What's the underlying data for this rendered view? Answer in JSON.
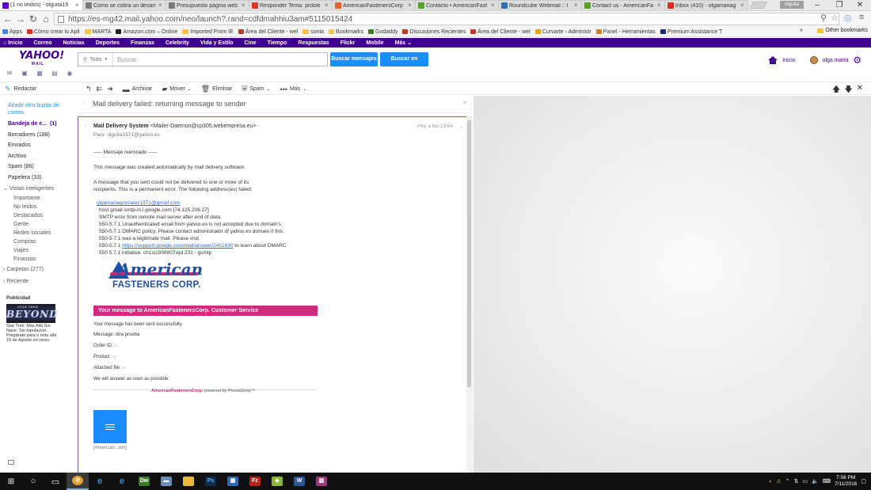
{
  "browser": {
    "tabs": [
      {
        "title": "(1 no leidos) - olguita19",
        "fav": "yahoo-mail-icon",
        "color": "#6001d2",
        "active": true
      },
      {
        "title": "Cómo se cobra un desarr",
        "fav": "page-icon",
        "color": "#7a7a7a",
        "active": false
      },
      {
        "title": "Presupuesto página web",
        "fav": "page-icon",
        "color": "#7a7a7a",
        "active": false
      },
      {
        "title": "Responder Tema: proble",
        "fav": "w-icon",
        "color": "#d9352b",
        "active": false
      },
      {
        "title": "AmericanFastenersCorp",
        "fav": "link-icon",
        "color": "#e8622c",
        "active": false
      },
      {
        "title": "Contacto • AmericanFast",
        "fav": "doc-icon",
        "color": "#5aa02c",
        "active": false
      },
      {
        "title": "Roundcube Webmail :: I",
        "fav": "roundcube-icon",
        "color": "#2b6fb5",
        "active": false
      },
      {
        "title": "Contact us - AmericanFa",
        "fav": "doc-icon",
        "color": "#5aa02c",
        "active": false
      },
      {
        "title": "Inbox (410) - olgamariag",
        "fav": "gmail-icon",
        "color": "#d93025",
        "active": false
      }
    ],
    "window_user": "olguita",
    "url": "https://es-mg42.mail.yahoo.com/neo/launch?.rand=cdfdmahhiu3am#5115015424",
    "bookmarks": [
      {
        "label": "Apps",
        "type": "grid"
      },
      {
        "label": "Cómo crear tu Apli",
        "type": "youtube"
      },
      {
        "label": "MARTA",
        "type": "folder"
      },
      {
        "label": "Amazon.com – Online",
        "type": "amazon"
      },
      {
        "label": "Imported From IE",
        "type": "folder"
      },
      {
        "label": "Área del Cliente - wel",
        "type": "w"
      },
      {
        "label": "sonia",
        "type": "folder"
      },
      {
        "label": "Bookmarks",
        "type": "star"
      },
      {
        "label": "Godaddy",
        "type": "godaddy"
      },
      {
        "label": "Discusiones Recientes",
        "type": "w"
      },
      {
        "label": "Área del Cliente - wel",
        "type": "w"
      },
      {
        "label": "Curvarte › Administr",
        "type": "curvarte"
      },
      {
        "label": "Panel - Herramientas",
        "type": "panel"
      },
      {
        "label": "Premium Assistance T",
        "type": "premium"
      }
    ],
    "other_bookmarks": "Other bookmarks",
    "more_bookmarks": "»"
  },
  "yahoo_nav": [
    "Inicio",
    "Correo",
    "Noticias",
    "Deportes",
    "Finanzas",
    "Celebrity",
    "Vida y Estilo",
    "Cine",
    "Tiempo",
    "Respuestas",
    "Flickr",
    "Mobile",
    "Más"
  ],
  "header": {
    "logo": "YAHOO!",
    "logo_sub": "MAIL",
    "search_scope": "Todo",
    "search_placeholder": "Buscar",
    "btn_search_mail": "Buscar mensajes",
    "btn_search_web": "Buscar en Internet",
    "home": "Inicio",
    "user": "olga maria"
  },
  "actions": {
    "compose": "Redactar",
    "archive": "Archivar",
    "move": "Mover",
    "delete": "Eliminar",
    "spam": "Spam",
    "more": "Más"
  },
  "sidebar": {
    "add_mailbox": "Añadir otro buzón de correo",
    "folders": [
      {
        "label": "Bandeja de e...",
        "count": "(1)",
        "bold": true
      },
      {
        "label": "Borradores (188)",
        "count": "",
        "bold": false
      },
      {
        "label": "Enviados",
        "count": "",
        "bold": false
      },
      {
        "label": "Archivo",
        "count": "",
        "bold": false
      },
      {
        "label": "Spam (86)",
        "count": "",
        "bold": false
      },
      {
        "label": "Papelera (33)",
        "count": "",
        "bold": false
      }
    ],
    "smart_views_title": "Vistas inteligentes",
    "smart_views": [
      "Importante",
      "No leídos",
      "Destacados",
      "Gente",
      "Redes sociales",
      "Compras",
      "Viajes",
      "Finanzas"
    ],
    "carpetas": "Carpetas (277)",
    "reciente": "Reciente",
    "ad_label": "Publicidad",
    "ad_title": "BEYOND",
    "ad_title_small": "STAR TREK",
    "ad_text": "Star Trek: Más Allá Sin Nave. Sin tripulación. Prepárate para ir más allá 19 de Agosto en cines"
  },
  "message": {
    "subject": "Mail delivery failed: returning message to sender",
    "from_name": "Mail Delivery System",
    "from_addr": "<Mailer-Daemon@cp305.webempresa.eu>",
    "to_label": "Para",
    "to_addr": "olguita1971@yahoo.es",
    "time": "Hoy a las 19:54",
    "forwarded": "----- Mensaje reenviado -----",
    "auto_line": "This message was created automatically by mail delivery software.",
    "err_line1": "A message that you sent could not be delivered to one or more of its",
    "err_line2": "recipients. This is a permanent error. The following address(es) failed:",
    "bounce": {
      "address": "olgamariagonzalez1971@gmail.com",
      "host": "host gmail-smtp-in.l.google.com [74.125.206.27]",
      "smtp": "SMTP error from remote mail server after end of data:",
      "l1": "550-5.7.1 Unauthenticated email from yahoo.es is not accepted due to domain's",
      "l2": "550-5.7.1 DMARC policy. Please contact administrator of yahoo.es domain if this",
      "l3": "550-5.7.1 was a legitimate mail. Please visit",
      "l4_pre": "550-5.7.1 ",
      "l4_link": "https://support.google.com/mail/answer/2451690",
      "l4_post": " to learn about DMARC",
      "l5": "550 5.7.1 initiative. ch1si1956907wjd.231 - gsmtp"
    },
    "logo_big": "American",
    "logo_sub": "FASTENERS CORP.",
    "banner": "Your message to AmericanFastenersCorp. Customer Service",
    "sent_ok": "Your message has been sent successfully.",
    "message_line": "Message: otra prueba",
    "order_line": "Order ID : -",
    "product_line": "Product : -",
    "attached_line": "Attached file : -",
    "answer_line": "We will answer as soon as possible.",
    "footer_brand": "AmericanFastenersCorp.",
    "footer_rest": " powered by PrestaShop™",
    "attachment_name": "[American...em]"
  },
  "taskbar": {
    "time": "7:56 PM",
    "date": "7/11/2016"
  }
}
